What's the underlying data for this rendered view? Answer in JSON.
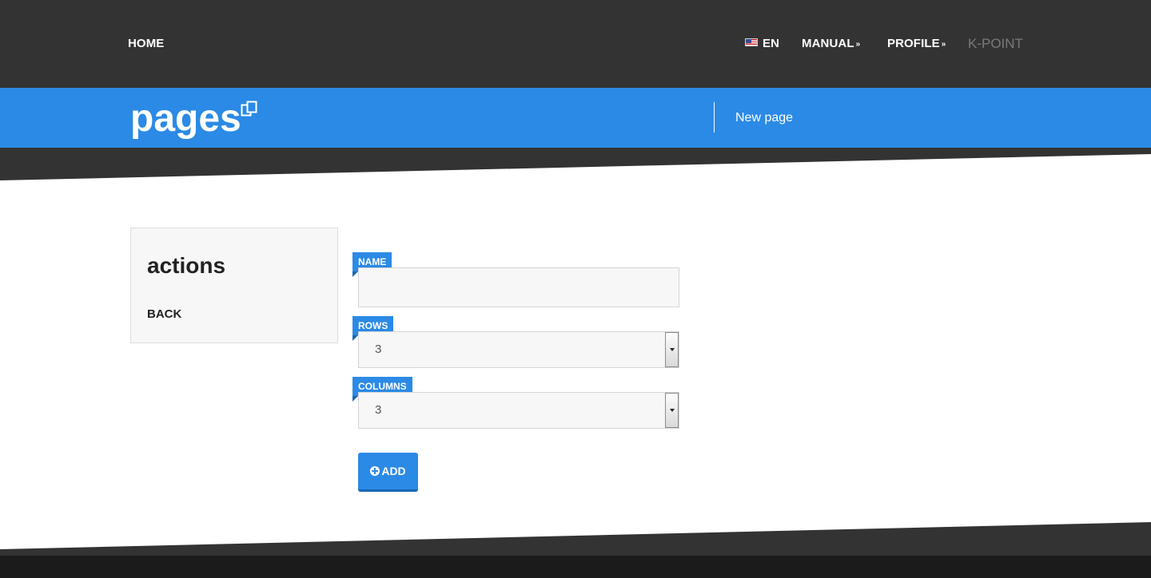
{
  "nav": {
    "home": "HOME",
    "language": "EN",
    "language_flag": "us-flag-icon",
    "manual": "MANUAL",
    "profile": "PROFILE",
    "brand": "K-POINT",
    "dropdown_icon": "double-chevron-down-icon"
  },
  "header": {
    "title": "pages",
    "title_icon": "copy-pages-icon",
    "link": "New page"
  },
  "sidebar": {
    "title": "actions",
    "back": "BACK"
  },
  "form": {
    "name_label": "NAME",
    "name_value": "",
    "rows_label": "ROWS",
    "rows_value": "3",
    "columns_label": "COLUMNS",
    "columns_value": "3",
    "add_label": "ADD",
    "add_icon": "plus-circle-icon"
  },
  "colors": {
    "topbar": "#333333",
    "accent": "#2b8ae6",
    "footer": "#1b1b1b"
  }
}
